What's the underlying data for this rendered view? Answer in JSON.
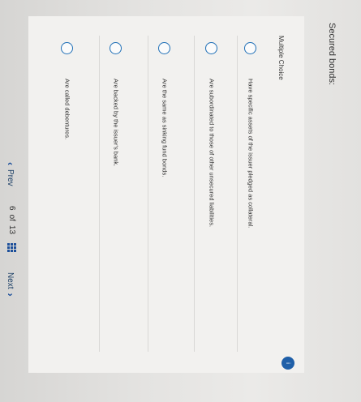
{
  "question": {
    "stem": "Secured bonds:",
    "type_label": "Multiple Choice"
  },
  "choices": [
    {
      "label": "Have specific assets of the issuer pledged as collateral."
    },
    {
      "label": "Are subordinated to those of other unsecured liabilities."
    },
    {
      "label": "Are the same as sinking fund bonds."
    },
    {
      "label": "Are backed by the issuer's bank."
    },
    {
      "label": "Are called debentures."
    }
  ],
  "navigation": {
    "prev_label": "Prev",
    "current_page": "6",
    "of_label": "of",
    "total_pages": "13",
    "next_label": "Next"
  },
  "colors": {
    "accent": "#1f6fb7",
    "nav_text": "#1c3f66"
  }
}
